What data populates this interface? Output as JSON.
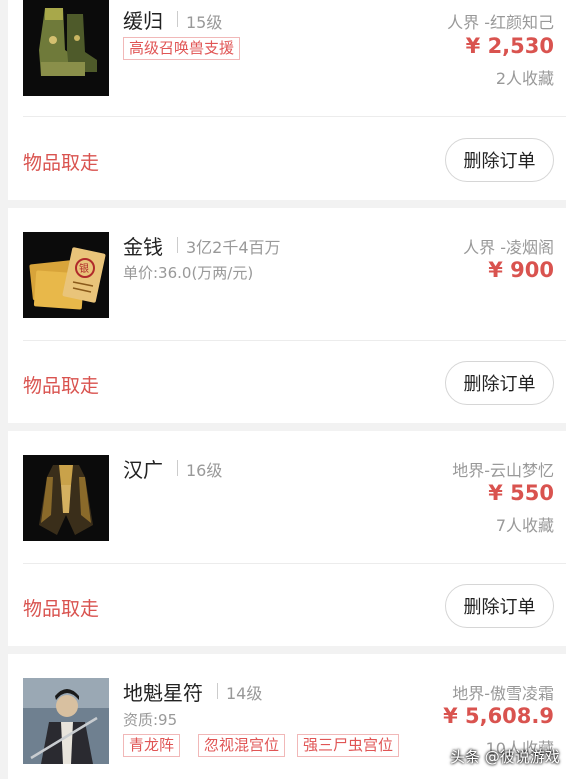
{
  "orders": [
    {
      "name": "缓归",
      "level": "15级",
      "tags": [
        "高级召唤兽支援"
      ],
      "server": "人界 -红颜知己",
      "price": "¥ 2,530",
      "favorites": "2人收藏",
      "status": "物品取走",
      "action": "删除订单",
      "icon": "boots-icon"
    },
    {
      "name": "金钱",
      "level": "3亿2千4百万",
      "unit_price": "单价:36.0(万两/元)",
      "server": "人界 -凌烟阁",
      "price": "¥ 900",
      "status": "物品取走",
      "action": "删除订单",
      "icon": "money-icon"
    },
    {
      "name": "汉广",
      "level": "16级",
      "server": "地界-云山梦忆",
      "price": "¥ 550",
      "favorites": "7人收藏",
      "status": "物品取走",
      "action": "删除订单",
      "icon": "robe-armor-icon"
    },
    {
      "name": "地魁星符",
      "level": "14级",
      "quality": "资质:95",
      "tags": [
        "青龙阵",
        "忽视混宫位",
        "强三尸虫宫位"
      ],
      "server": "地界-傲雪凌霜",
      "price": "¥ 5,608.9",
      "favorites": "10人收藏",
      "icon": "warrior-portrait-icon"
    }
  ],
  "watermark": "头条 @彼说游戏",
  "colors": {
    "accent": "#d9534f",
    "background": "#f2f2f2",
    "muted": "#999999"
  }
}
